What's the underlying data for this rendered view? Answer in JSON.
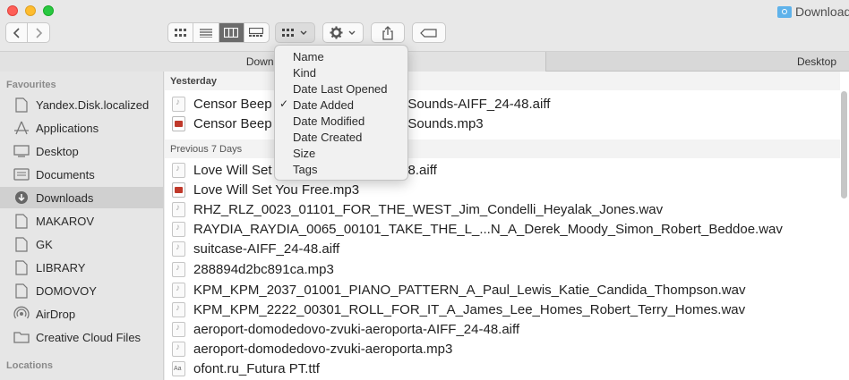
{
  "window": {
    "title": "Download"
  },
  "tabs": [
    {
      "label": "Downloads"
    },
    {
      "label": "Desktop"
    }
  ],
  "sidebar": {
    "favourites_heading": "Favourites",
    "locations_heading": "Locations",
    "items": [
      {
        "label": "Yandex.Disk.localized",
        "icon": "document-icon"
      },
      {
        "label": "Applications",
        "icon": "applications-icon"
      },
      {
        "label": "Desktop",
        "icon": "desktop-icon"
      },
      {
        "label": "Documents",
        "icon": "documents-icon"
      },
      {
        "label": "Downloads",
        "icon": "downloads-icon",
        "selected": true
      },
      {
        "label": "MAKAROV",
        "icon": "document-icon"
      },
      {
        "label": "GK",
        "icon": "document-icon"
      },
      {
        "label": "LIBRARY",
        "icon": "document-icon"
      },
      {
        "label": "DOMOVOY",
        "icon": "document-icon"
      },
      {
        "label": "AirDrop",
        "icon": "airdrop-icon"
      },
      {
        "label": "Creative Cloud Files",
        "icon": "folder-icon"
      }
    ]
  },
  "groups": {
    "yesterday": "Yesterday",
    "previous7": "Previous 7 Days"
  },
  "files": {
    "yesterday": [
      {
        "name": "Censor Beep",
        "suffix": "ts All Sounds-AIFF_24-48.aiff",
        "icon": "audio-file-icon"
      },
      {
        "name": "Censor Beep",
        "suffix": "ts All Sounds.mp3",
        "icon": "mp3-file-icon"
      }
    ],
    "previous7": [
      {
        "name": "Love Will Set",
        "suffix": "8.aiff",
        "icon": "audio-file-icon"
      },
      {
        "name": "Love Will Set You Free.mp3",
        "icon": "mp3-file-icon"
      },
      {
        "name": "RHZ_RLZ_0023_01101_FOR_THE_WEST_Jim_Condelli_Heyalak_Jones.wav",
        "icon": "audio-file-icon"
      },
      {
        "name": "RAYDIA_RAYDIA_0065_00101_TAKE_THE_L_...N_A_Derek_Moody_Simon_Robert_Beddoe.wav",
        "icon": "audio-file-icon"
      },
      {
        "name": "suitcase-AIFF_24-48.aiff",
        "icon": "audio-file-icon"
      },
      {
        "name": "288894d2bc891ca.mp3",
        "icon": "audio-file-icon"
      },
      {
        "name": "KPM_KPM_2037_01001_PIANO_PATTERN_A_Paul_Lewis_Katie_Candida_Thompson.wav",
        "icon": "audio-file-icon"
      },
      {
        "name": "KPM_KPM_2222_00301_ROLL_FOR_IT_A_James_Lee_Homes_Robert_Terry_Homes.wav",
        "icon": "audio-file-icon"
      },
      {
        "name": "aeroport-domodedovo-zvuki-aeroporta-AIFF_24-48.aiff",
        "icon": "audio-file-icon"
      },
      {
        "name": "aeroport-domodedovo-zvuki-aeroporta.mp3",
        "icon": "audio-file-icon"
      },
      {
        "name": "ofont.ru_Futura PT.ttf",
        "icon": "font-file-icon"
      }
    ]
  },
  "sort_menu": {
    "items": [
      {
        "label": "Name",
        "checked": false
      },
      {
        "label": "Kind",
        "checked": false
      },
      {
        "label": "Date Last Opened",
        "checked": false
      },
      {
        "label": "Date Added",
        "checked": true
      },
      {
        "label": "Date Modified",
        "checked": false
      },
      {
        "label": "Date Created",
        "checked": false
      },
      {
        "label": "Size",
        "checked": false
      },
      {
        "label": "Tags",
        "checked": false
      }
    ],
    "checkmark": "✓"
  },
  "colors": {
    "close": "#fe5f57",
    "minimize": "#febc2e",
    "maximize": "#28c840",
    "folder_accent": "#5fb2ea",
    "mp3_icon": "#c0392b"
  }
}
